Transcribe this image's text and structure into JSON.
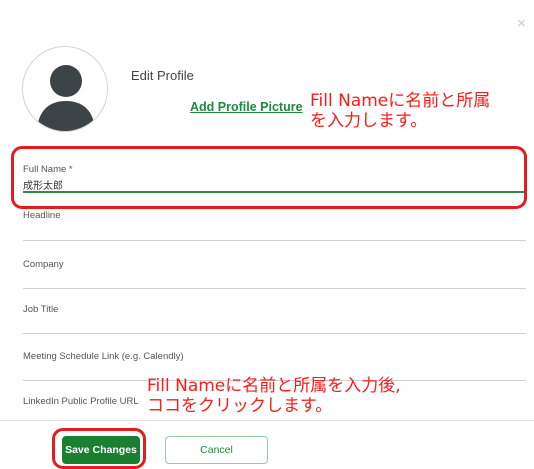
{
  "modal": {
    "title": "Edit Profile",
    "close_label": "×",
    "add_picture_label": "Add Profile Picture"
  },
  "fields": {
    "full_name": {
      "label": "Full Name *",
      "value": "成形太郎"
    },
    "headline": {
      "label": "Headline",
      "value": ""
    },
    "company": {
      "label": "Company",
      "value": ""
    },
    "job_title": {
      "label": "Job Title",
      "value": ""
    },
    "meeting_link": {
      "label": "Meeting Schedule Link (e.g. Calendly)",
      "value": ""
    },
    "linkedin": {
      "label": "LinkedIn Public Profile URL",
      "value": ""
    }
  },
  "buttons": {
    "save_label": "Save Changes",
    "cancel_label": "Cancel"
  },
  "annotations": {
    "note1_line1": "Fill Nameに名前と所属",
    "note1_line2": "を入力します。",
    "note2_line1": "Fill Nameに名前と所属を入力後,",
    "note2_line2": "ココをクリックします。"
  },
  "colors": {
    "accent": "#1a7f31",
    "annotation": "#ff1a1a"
  }
}
